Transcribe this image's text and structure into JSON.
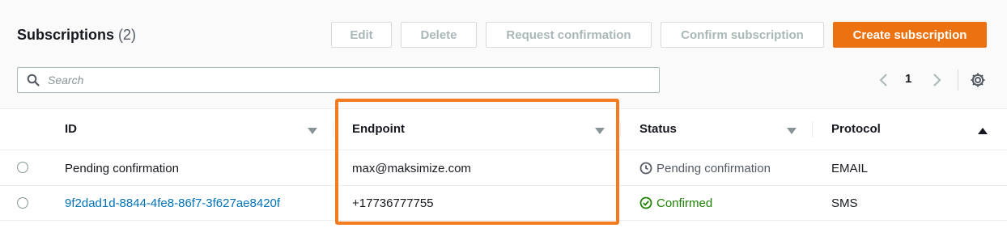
{
  "header": {
    "title": "Subscriptions",
    "count": "(2)"
  },
  "toolbar": {
    "edit_label": "Edit",
    "delete_label": "Delete",
    "request_confirmation_label": "Request confirmation",
    "confirm_subscription_label": "Confirm subscription",
    "create_subscription_label": "Create subscription"
  },
  "search": {
    "placeholder": "Search",
    "value": ""
  },
  "pagination": {
    "current_page": "1"
  },
  "table": {
    "columns": [
      "ID",
      "Endpoint",
      "Status",
      "Protocol"
    ],
    "rows": [
      {
        "id": "Pending confirmation",
        "endpoint": "max@maksimize.com",
        "status": "Pending confirmation",
        "status_type": "pending",
        "protocol": "EMAIL"
      },
      {
        "id": "9f2dad1d-8844-4fe8-86f7-3f627ae8420f",
        "endpoint": "+17736777755",
        "status": "Confirmed",
        "status_type": "confirmed",
        "protocol": "SMS"
      }
    ]
  },
  "colors": {
    "primary_button": "#ec7211",
    "highlight_outline": "#f47c20",
    "link": "#0073bb",
    "confirmed": "#1d8102"
  },
  "icons": [
    "search-icon",
    "chevron-left-icon",
    "chevron-right-icon",
    "gear-icon",
    "sort-down-icon",
    "sort-up-icon",
    "clock-icon",
    "check-circle-icon"
  ]
}
